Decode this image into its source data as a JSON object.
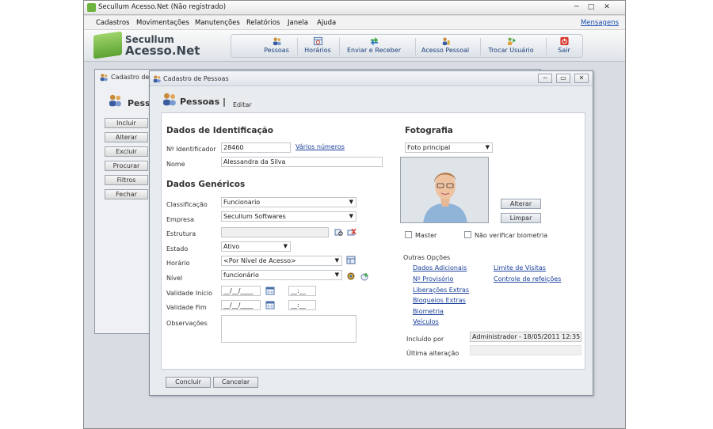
{
  "window": {
    "title": "Secullum Acesso.Net (Não registrado)",
    "controls": [
      "─",
      "□",
      "✕"
    ]
  },
  "menu": {
    "items": [
      "Cadastros",
      "Movimentações",
      "Manutenções",
      "Relatórios",
      "Janela",
      "Ajuda"
    ],
    "messages": "Mensagens"
  },
  "logo": {
    "line1": "Secullum",
    "line2": "Acesso.Net"
  },
  "toolbar": {
    "buttons": [
      "Pessoas",
      "Horários",
      "Enviar e Receber",
      "Acesso Pessoal",
      "Trocar Usuário",
      "Sair"
    ]
  },
  "back_window": {
    "title": "Cadastro de P",
    "header": "Pess",
    "buttons": [
      "Incluir",
      "Alterar",
      "Excluir",
      "Procurar",
      "Filtros",
      "Fechar"
    ]
  },
  "form": {
    "title": "Cadastro de Pessoas",
    "header": "Pessoas |",
    "mode": "Editar",
    "section_ident": "Dados de Identificação",
    "label_id": "Nº Identificador",
    "id_value": "28460",
    "link_varios": "Vários números",
    "label_nome": "Nome",
    "nome_value": "Alessandra da Silva",
    "section_generic": "Dados Genéricos",
    "label_classificacao": "Classificação",
    "classificacao_value": "Funcionario",
    "label_empresa": "Empresa",
    "empresa_value": "Secullum Softwares",
    "label_estrutura": "Estrutura",
    "label_estado": "Estado",
    "estado_value": "Ativo",
    "label_horario": "Horário",
    "horario_value": "<Por Nível de Acesso>",
    "label_nivel": "Nível",
    "nivel_value": "funcionário",
    "label_validade_inicio": "Validade Início",
    "label_validade_fim": "Validade Fim",
    "date_mask": "__/__/____",
    "time_mask": "__:__",
    "label_observacoes": "Observações",
    "section_photo": "Fotografia",
    "photo_select": "Foto principal",
    "btn_alterar": "Alterar",
    "btn_limpar": "Limpar",
    "chk_master": "Master",
    "chk_biometria": "Não verificar biometria",
    "outras_opcoes": "Outras Opções",
    "links_left": [
      "Dados Adicionais",
      "Nº Provisório",
      "Liberações Extras",
      "Bloqueios Extras",
      "Biometria",
      "Veículos"
    ],
    "links_right": [
      "Limite de Visitas",
      "Controle de refeições"
    ],
    "label_incluido": "Incluído por",
    "incluido_value": "Administrador - 18/05/2011 12:35",
    "label_ultima": "Última alteração",
    "btn_concluir": "Concluir",
    "btn_cancelar": "Cancelar"
  }
}
